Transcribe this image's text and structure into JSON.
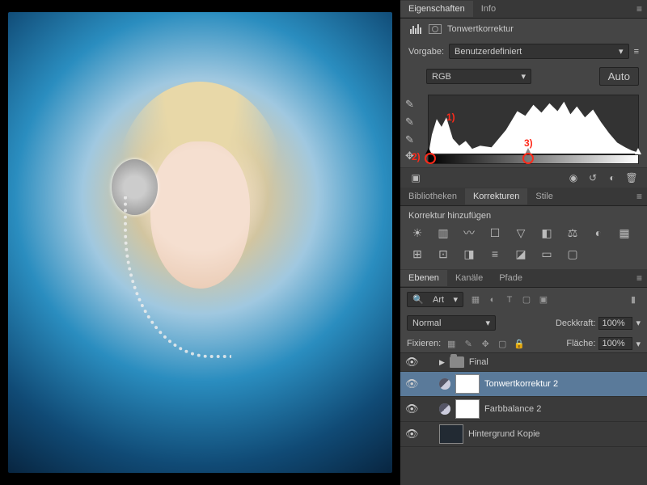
{
  "panels": {
    "properties_tab": "Eigenschaften",
    "info_tab": "Info",
    "adj_name": "Tonwertkorrektur",
    "preset_label": "Vorgabe:",
    "preset_value": "Benutzerdefiniert",
    "channel_value": "RGB",
    "auto_label": "Auto",
    "annotations": {
      "one": "1)",
      "two": "2)",
      "three": "3)"
    }
  },
  "adjustments": {
    "lib_tab": "Bibliotheken",
    "adj_tab": "Korrekturen",
    "styles_tab": "Stile",
    "add_label": "Korrektur hinzufügen"
  },
  "layers": {
    "layers_tab": "Ebenen",
    "channels_tab": "Kanäle",
    "paths_tab": "Pfade",
    "filter_kind": "Art",
    "blend_mode": "Normal",
    "opacity_label": "Deckkraft:",
    "opacity_value": "100%",
    "lock_label": "Fixieren:",
    "fill_label": "Fläche:",
    "fill_value": "100%",
    "rows": {
      "folder": "Final",
      "levels": "Tonwertkorrektur 2",
      "colorbal": "Farbbalance 2",
      "bgcopy": "Hintergrund Kopie"
    }
  }
}
